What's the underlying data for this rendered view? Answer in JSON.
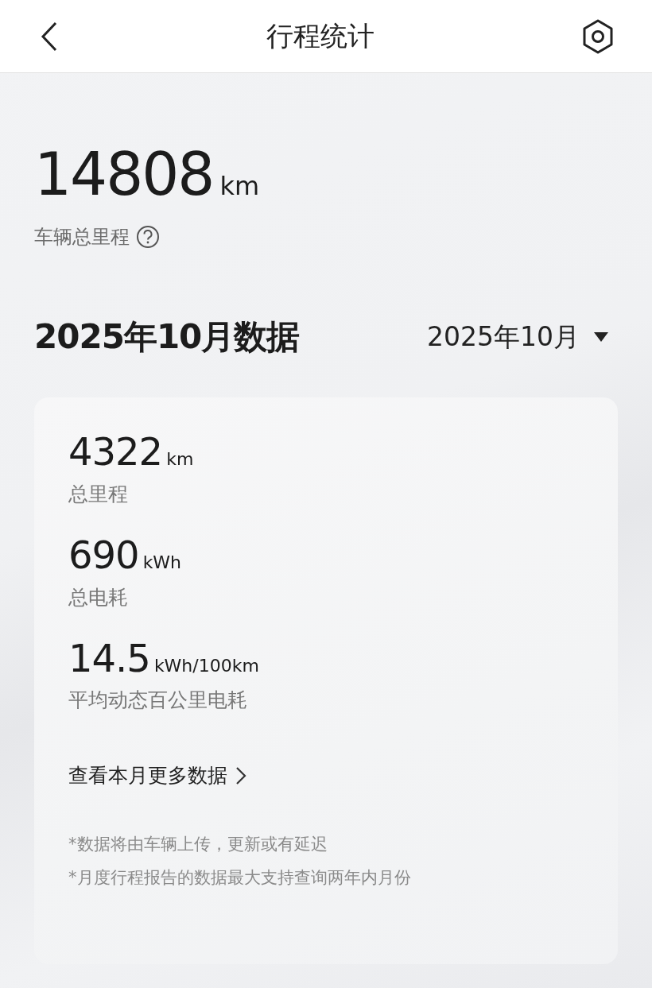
{
  "header": {
    "title": "行程统计"
  },
  "total": {
    "value": "14808",
    "unit": "km",
    "label": "车辆总里程"
  },
  "section": {
    "title": "2025年10月数据",
    "month_picker": "2025年10月"
  },
  "stats": [
    {
      "value": "4322",
      "unit": "km",
      "label": "总里程"
    },
    {
      "value": "690",
      "unit": "kWh",
      "label": "总电耗"
    },
    {
      "value": "14.5",
      "unit": "kWh/100km",
      "label": "平均动态百公里电耗"
    }
  ],
  "more_link": "查看本月更多数据",
  "notes": [
    "*数据将由车辆上传，更新或有延迟",
    "*月度行程报告的数据最大支持查询两年内月份"
  ]
}
